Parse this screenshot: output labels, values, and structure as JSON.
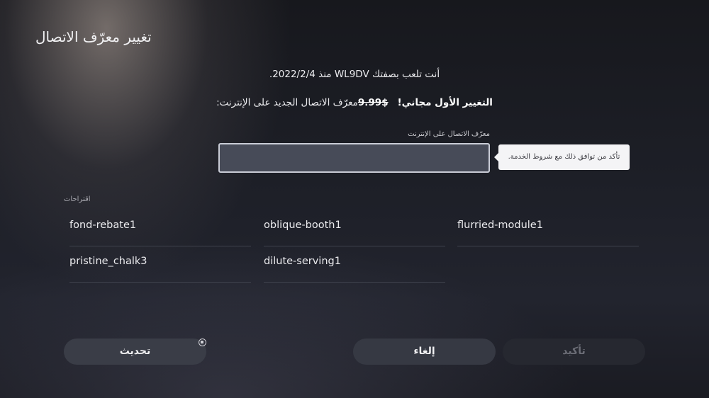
{
  "page": {
    "title": "تغيير معرّف الاتصال"
  },
  "info": {
    "since_line": "أنت تلعب بصفتك WL9DV منذ 2022/2/4.",
    "free_change": "التغيير الأول مجاني!",
    "old_price": "$9.99",
    "enter_new": "معرّف الاتصال الجديد على الإنترنت:"
  },
  "online_id_field": {
    "label": "معرّف الاتصال على الإنترنت",
    "value": ""
  },
  "tooltip": {
    "text": "تأكد من توافق ذلك مع شروط الخدمة."
  },
  "suggestions": {
    "label": "اقتراحات",
    "items": [
      "flurried-module1",
      "oblique-booth1",
      "fond-rebate1",
      "dilute-serving1",
      "pristine_chalk3"
    ]
  },
  "buttons": {
    "confirm": "تأكيد",
    "cancel": "إلغاء",
    "refresh": "تحديث"
  },
  "icons": {
    "refresh_hint": "square-button-icon"
  }
}
